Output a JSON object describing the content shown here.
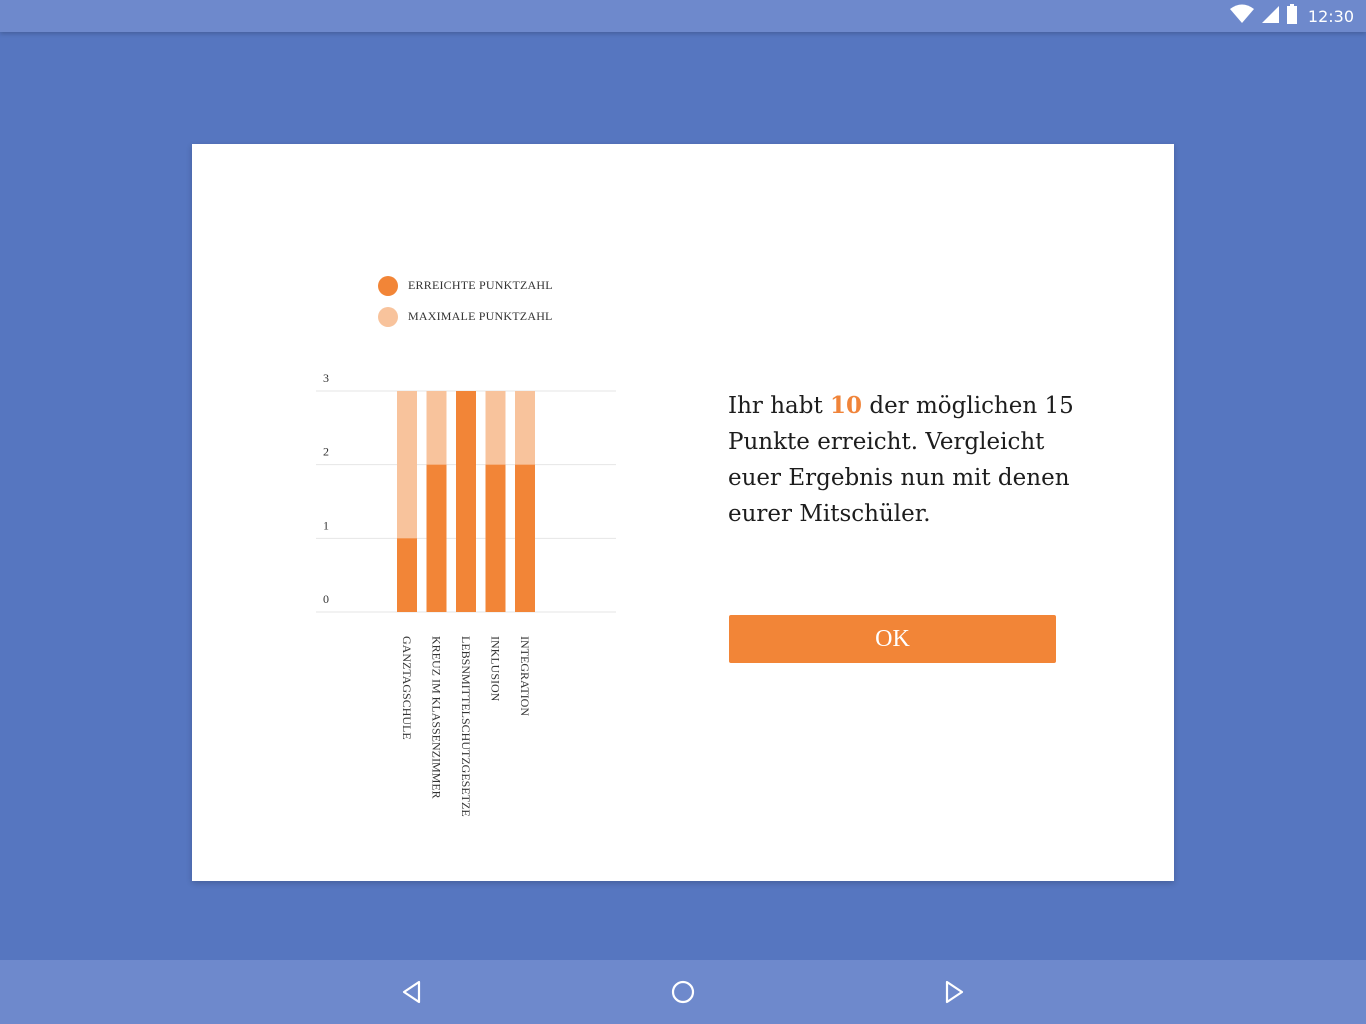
{
  "status_bar": {
    "time": "12:30",
    "icons": [
      "wifi-icon",
      "signal-icon",
      "battery-icon"
    ]
  },
  "dialog": {
    "legend": [
      {
        "label": "ERREICHTE PUNKTZAHL",
        "color": "#f28537"
      },
      {
        "label": "MAXIMALE PUNKTZAHL",
        "color": "#f8c39c"
      }
    ],
    "message": {
      "prefix": "Ihr habt ",
      "score": "10",
      "suffix": " der möglichen 15 Punkte erreicht. Vergleicht euer Ergebnis nun mit denen eurer Mitschüler."
    },
    "ok_label": "OK"
  },
  "colors": {
    "achieved": "#f28537",
    "maximum": "#f8c39c",
    "accent": "#f0843a",
    "background": "#5676c0",
    "bars": "#6e89cc"
  },
  "chart_data": {
    "type": "bar",
    "categories": [
      "GANZTAGSCHULE",
      "KREUZ IM KLASSENZIMMER",
      "LEBSNMITTELSCHUTZGESETZE",
      "INKLUSION",
      "INTEGRATION"
    ],
    "series": [
      {
        "name": "ERREICHTE PUNKTZAHL",
        "values": [
          1,
          2,
          3,
          2,
          2
        ]
      },
      {
        "name": "MAXIMALE PUNKTZAHL",
        "values": [
          3,
          3,
          3,
          3,
          3
        ]
      }
    ],
    "y_ticks": [
      "0",
      "1",
      "2",
      "3"
    ],
    "ylim": [
      0,
      3
    ],
    "grid": true,
    "legend_position": "top-left",
    "tick_label_orientation": "vertical"
  },
  "nav_bar": {
    "icons": [
      "back-icon",
      "home-icon",
      "recents-icon"
    ]
  }
}
